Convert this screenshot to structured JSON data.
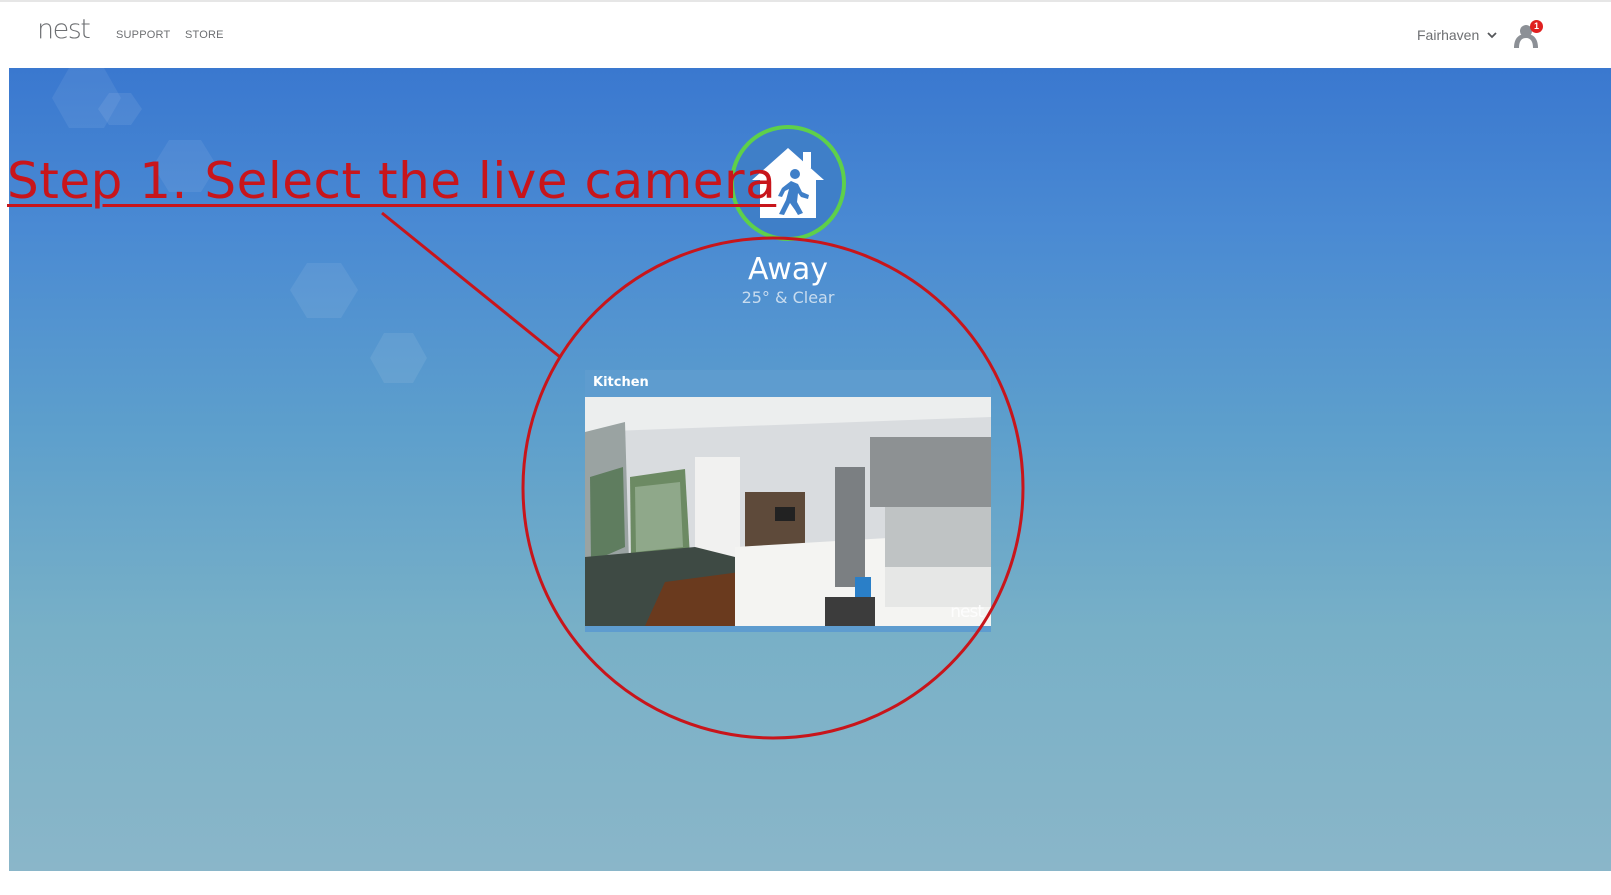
{
  "header": {
    "logo": "nest",
    "nav": [
      {
        "label": "SUPPORT"
      },
      {
        "label": "STORE"
      }
    ],
    "home_name": "Fairhaven",
    "notification_count": "1"
  },
  "status": {
    "mode": "Away",
    "weather": "25° & Clear",
    "ring_color": "#5ed04a"
  },
  "camera": {
    "name": "Kitchen",
    "watermark": "nest"
  },
  "annotation": {
    "text": "Step 1. Select the live camera",
    "color": "#c8151b"
  }
}
